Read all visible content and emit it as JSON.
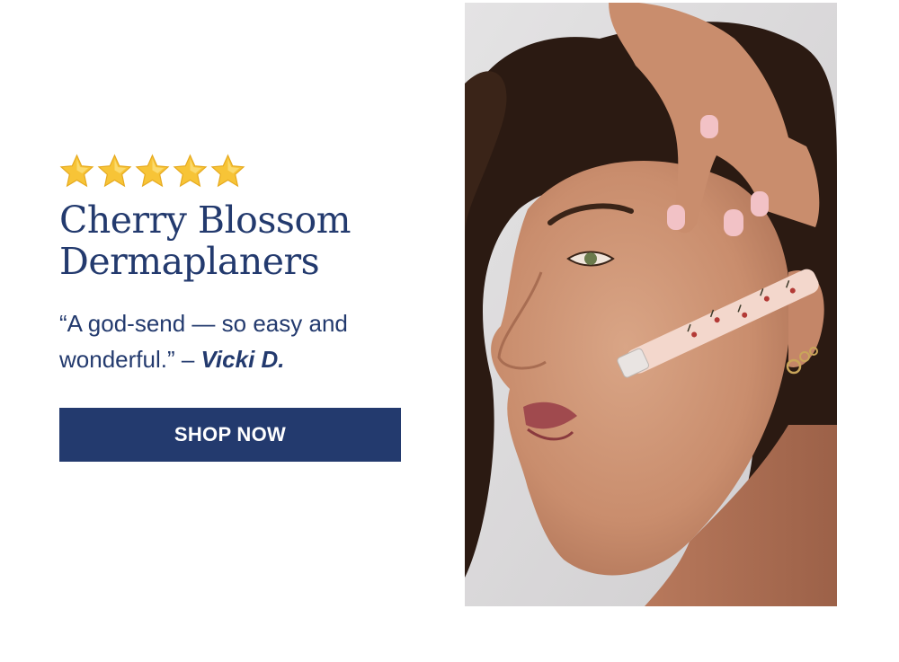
{
  "rating": {
    "stars": 5,
    "star_icon": "star-icon",
    "star_color": "#F7C437"
  },
  "product": {
    "title_line1": "Cherry Blossom",
    "title_line2": "Dermaplaners"
  },
  "review": {
    "quote": "“A god-send — so easy and wonderful.” –",
    "author": "Vicki D."
  },
  "cta": {
    "label": "SHOP NOW"
  },
  "colors": {
    "brand": "#233A6E",
    "background": "#FFFFFF"
  },
  "image": {
    "icon": "model-dermaplaning-photo"
  }
}
